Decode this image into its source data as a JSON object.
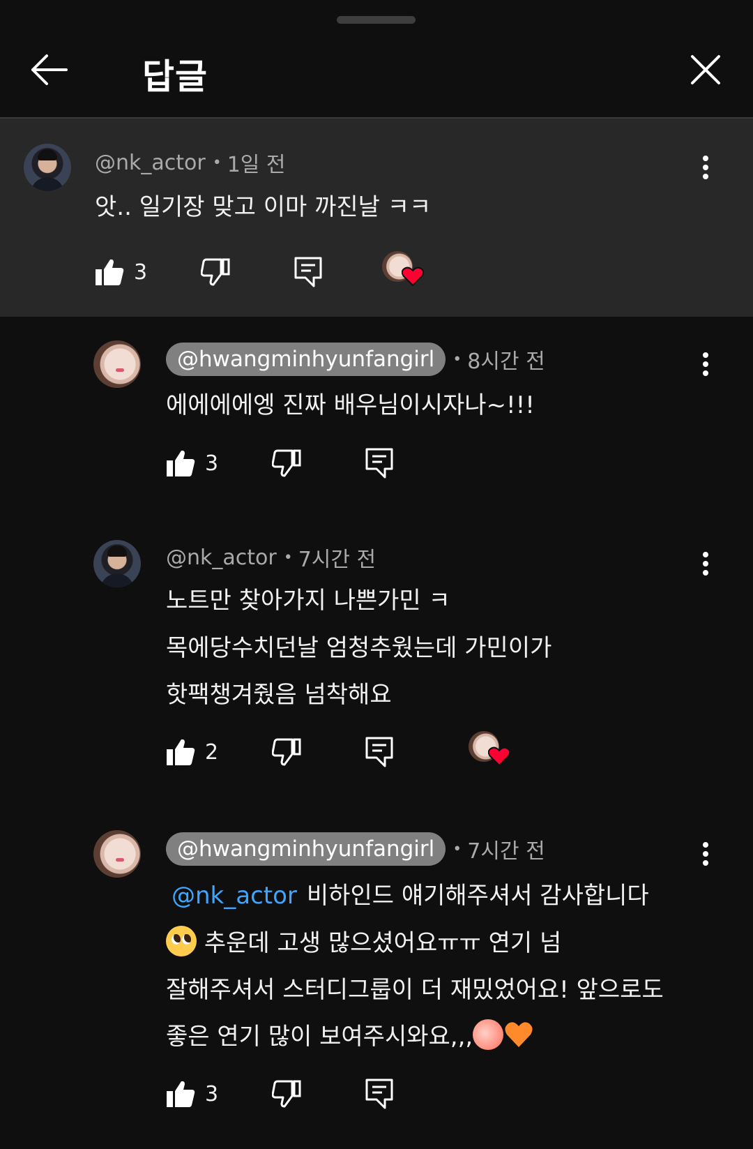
{
  "header": {
    "title": "답글"
  },
  "parent": {
    "handle": "@nk_actor",
    "time": "1일 전",
    "text": "앗.. 일기장 맞고 이마 까진날 ㅋㅋ",
    "likes": "3",
    "hearted": true
  },
  "replies": [
    {
      "handle": "@hwangminhyunfangirl",
      "time": "8시간 전",
      "lines": [
        "에에에에엥 진짜 배우님이시자나~!!!"
      ],
      "likes": "3",
      "hearted": false
    },
    {
      "handle": "@nk_actor",
      "time": "7시간 전",
      "lines": [
        "노트만 찾아가지 나쁜가민 ㅋ",
        "목에당수치던날 엄청추웠는데 가민이가",
        "핫팩챙겨줬음 넘착해요"
      ],
      "likes": "2",
      "hearted": true
    },
    {
      "handle": "@hwangminhyunfangirl",
      "time": "7시간 전",
      "mention": "@nk_actor",
      "lines": [
        "비하인드 얘기해주셔서 감사합니다",
        "추운데 고생 많으셨어요ㅠㅠ 연기 넘",
        "잘해주셔서 스터디그룹이 더 재밌었어요! 앞으로도",
        "좋은 연기 많이 보여주시와요,,,"
      ],
      "likes": "3",
      "hearted": false
    }
  ],
  "icons": {
    "back": "arrow-left-icon",
    "close": "close-icon",
    "more": "more-vert-icon",
    "like": "thumb-up-icon",
    "dislike": "thumb-down-icon",
    "reply": "reply-comment-icon",
    "heart": "creator-heart-icon"
  },
  "colors": {
    "background": "#0f0f0f",
    "highlight": "#282828",
    "mention": "#3ea6ff",
    "heart": "#ff0033",
    "handle_chip": "#808080"
  }
}
